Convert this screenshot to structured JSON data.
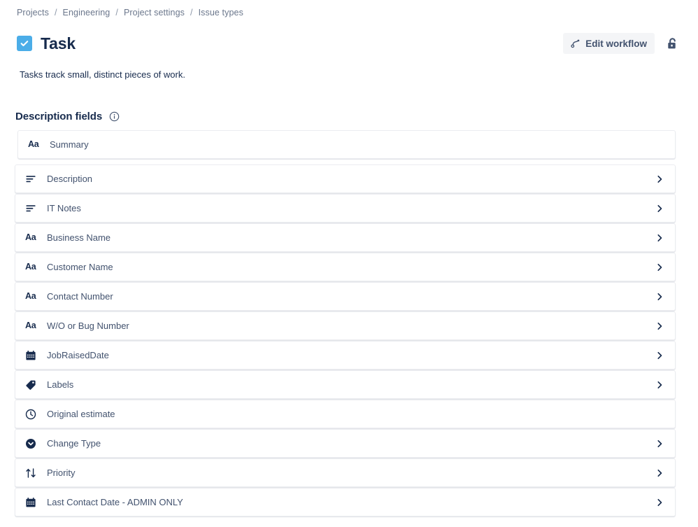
{
  "breadcrumb": {
    "separator": "/",
    "items": [
      {
        "label": "Projects",
        "link": true
      },
      {
        "label": "Engineering",
        "link": true
      },
      {
        "label": "Project settings",
        "link": true
      },
      {
        "label": "Issue types",
        "link": false
      }
    ]
  },
  "header": {
    "title": "Task",
    "issue_type_icon": "task-checkbox-icon",
    "icon_color": "#4BADE8",
    "description": "Tasks track small, distinct pieces of work.",
    "edit_workflow_label": "Edit workflow",
    "edit_workflow_icon": "workflow-icon",
    "lock_icon": "unlocked-padlock-icon"
  },
  "section": {
    "title": "Description fields",
    "info_icon": "info-circle-icon"
  },
  "fields": [
    {
      "label": "Summary",
      "icon": "text-field-icon",
      "icon_type": "aa",
      "expandable": false,
      "inset": true
    },
    {
      "label": "Description",
      "icon": "paragraph-icon",
      "icon_type": "lines",
      "expandable": true,
      "inset": false
    },
    {
      "label": "IT Notes",
      "icon": "paragraph-icon",
      "icon_type": "lines",
      "expandable": true,
      "inset": false
    },
    {
      "label": "Business Name",
      "icon": "text-field-icon",
      "icon_type": "aa",
      "expandable": true,
      "inset": false
    },
    {
      "label": "Customer Name",
      "icon": "text-field-icon",
      "icon_type": "aa",
      "expandable": true,
      "inset": false
    },
    {
      "label": "Contact Number",
      "icon": "text-field-icon",
      "icon_type": "aa",
      "expandable": true,
      "inset": false
    },
    {
      "label": "W/O or Bug Number",
      "icon": "text-field-icon",
      "icon_type": "aa",
      "expandable": true,
      "inset": false
    },
    {
      "label": "JobRaisedDate",
      "icon": "calendar-icon",
      "icon_type": "calendar",
      "expandable": true,
      "inset": false
    },
    {
      "label": "Labels",
      "icon": "tag-icon",
      "icon_type": "tag",
      "expandable": true,
      "inset": false
    },
    {
      "label": "Original estimate",
      "icon": "clock-icon",
      "icon_type": "clock",
      "expandable": false,
      "inset": false
    },
    {
      "label": "Change Type",
      "icon": "select-dropdown-icon",
      "icon_type": "select",
      "expandable": true,
      "inset": false
    },
    {
      "label": "Priority",
      "icon": "priority-arrows-icon",
      "icon_type": "priority",
      "expandable": true,
      "inset": false
    },
    {
      "label": "Last Contact Date - ADMIN ONLY",
      "icon": "calendar-icon",
      "icon_type": "calendar",
      "expandable": true,
      "inset": false
    }
  ],
  "colors": {
    "accent": "#4BADE8",
    "text_primary": "#172B4D",
    "text_secondary": "#42526E",
    "text_muted": "#6B778C",
    "row_border": "#EBECF0",
    "button_bg": "#F4F5F7"
  }
}
